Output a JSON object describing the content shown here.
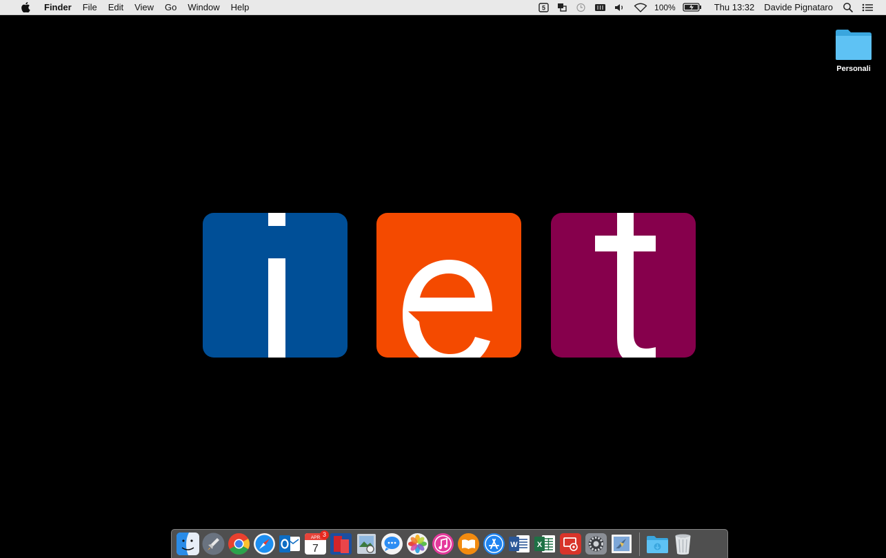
{
  "menubar": {
    "app_name": "Finder",
    "menus": [
      "File",
      "Edit",
      "View",
      "Go",
      "Window",
      "Help"
    ],
    "status_items": [
      "five-icon",
      "screen-share-icon",
      "time-machine-icon",
      "battery-meter-icon",
      "volume-icon",
      "wifi-icon"
    ],
    "battery_percent": "100%",
    "clock": "Thu 13:32",
    "user": "Davide Pignataro"
  },
  "desktop": {
    "folder_label": "Personali",
    "folder_color": "#4bb8ef"
  },
  "wallpaper": {
    "letters": [
      "i",
      "e",
      "t"
    ],
    "colors": [
      "#004f97",
      "#f44a00",
      "#86004c"
    ]
  },
  "dock": {
    "apps": [
      {
        "name": "finder",
        "color": "#2a8ce8"
      },
      {
        "name": "launchpad",
        "color": "#6a7380"
      },
      {
        "name": "chrome",
        "color": "#e9412f"
      },
      {
        "name": "safari",
        "color": "#1d8ef0"
      },
      {
        "name": "outlook",
        "color": "#0d6dc4"
      },
      {
        "name": "calendar",
        "color": "#ffffff",
        "month": "APR",
        "day": "7",
        "badge": "3"
      },
      {
        "name": "parallels",
        "color": "#d2242a"
      },
      {
        "name": "preview",
        "color": "#c9d3df"
      },
      {
        "name": "messages",
        "color": "#2c8df3"
      },
      {
        "name": "photos",
        "color": "#f2f2f2"
      },
      {
        "name": "itunes",
        "color": "#e53a9c"
      },
      {
        "name": "ibooks",
        "color": "#f28b10"
      },
      {
        "name": "app-store",
        "color": "#1f84f0"
      },
      {
        "name": "word",
        "color": "#2b5797",
        "letter": "W"
      },
      {
        "name": "excel",
        "color": "#1e7145",
        "letter": "X"
      },
      {
        "name": "remote-desktop",
        "color": "#d8342a"
      },
      {
        "name": "system-preferences",
        "color": "#8b8f96"
      },
      {
        "name": "mail-app",
        "color": "#7da7d8"
      },
      {
        "name": "downloads-folder",
        "color": "#4bb8ef"
      },
      {
        "name": "trash",
        "color": "#dfe3e6"
      }
    ]
  }
}
